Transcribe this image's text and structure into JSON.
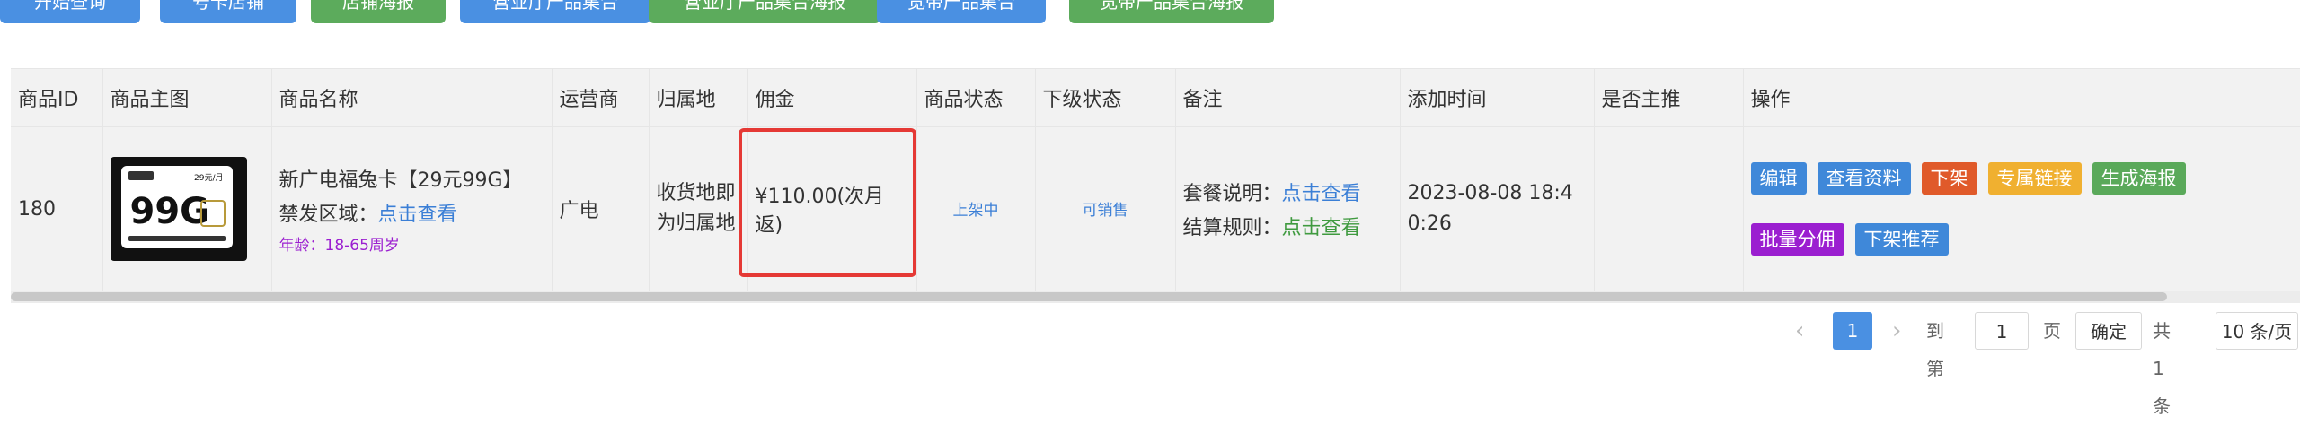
{
  "toolbar": {
    "buttons": [
      {
        "label": "开始查询",
        "color": "blue"
      },
      {
        "label": "号卡店铺",
        "color": "blue"
      },
      {
        "label": "店铺海报",
        "color": "green"
      },
      {
        "label": "营业厅产品集合",
        "color": "blue"
      },
      {
        "label": "营业厅产品集合海报",
        "color": "green"
      },
      {
        "label": "宽带产品集合",
        "color": "blue"
      },
      {
        "label": "宽带产品集合海报",
        "color": "green"
      }
    ]
  },
  "table": {
    "headers": [
      "商品ID",
      "商品主图",
      "商品名称",
      "运营商",
      "归属地",
      "佣金",
      "商品状态",
      "下级状态",
      "备注",
      "添加时间",
      "是否主推",
      "操作"
    ],
    "row": {
      "id": "180",
      "image_text": {
        "big": "99G",
        "top_right": "29元/月"
      },
      "name": "新广电福兔卡【29元99G】",
      "restricted_label": "禁发区域：",
      "restricted_link": "点击查看",
      "age": "年龄：18-65周岁",
      "operator": "广电",
      "region": "收货地即为归属地",
      "commission": "¥110.00(次月返)",
      "status": "上架中",
      "sub_status": "可销售",
      "remark_plan_label": "套餐说明：",
      "remark_plan_link": "点击查看",
      "remark_settle_label": "结算规则：",
      "remark_settle_link": "点击查看",
      "added_time": "2023-08-08 18:40:26",
      "is_featured": "",
      "actions": [
        "编辑",
        "查看资料",
        "下架",
        "专属链接",
        "生成海报",
        "批量分佣",
        "下架推荐"
      ]
    }
  },
  "pagination": {
    "current_page": "1",
    "goto_label": "到第",
    "goto_value": "1",
    "page_unit": "页",
    "confirm": "确定",
    "total": "共 1 条",
    "page_size": "10 条/页"
  },
  "colors": {
    "primary": "#4a90e2",
    "success": "#5cab5c",
    "danger": "#e05a2a",
    "warning": "#f0b030",
    "purple": "#9b1fd0",
    "highlight_border": "#e53935"
  }
}
